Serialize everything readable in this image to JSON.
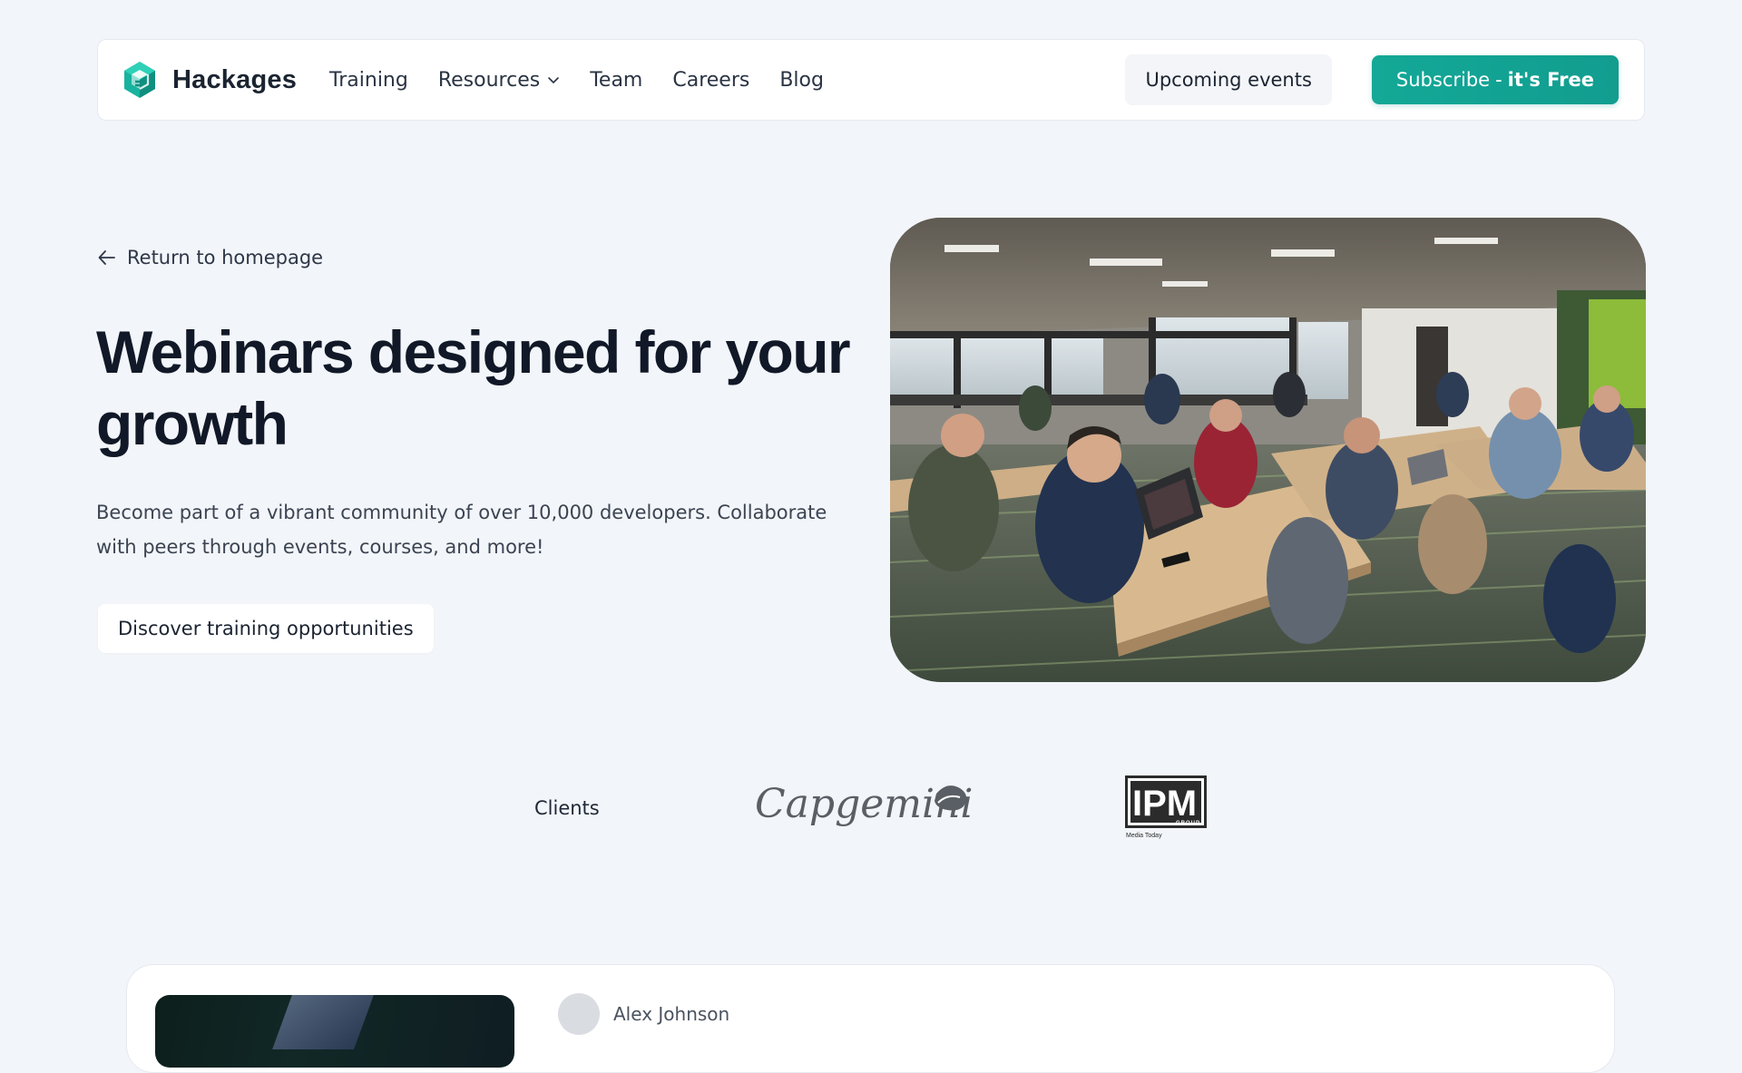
{
  "nav": {
    "brand": "Hackages",
    "links": [
      {
        "label": "Training"
      },
      {
        "label": "Resources",
        "has_dropdown": true
      },
      {
        "label": "Team"
      },
      {
        "label": "Careers"
      },
      {
        "label": "Blog"
      }
    ],
    "events_label": "Upcoming events",
    "subscribe": {
      "label": "Subscribe",
      "separator": "-",
      "emphasis": "it's Free"
    }
  },
  "hero": {
    "back_label": "Return to homepage",
    "title": "Webinars designed for your growth",
    "description": "Become part of a vibrant community of over 10,000 developers. Collaborate with peers through events, courses, and more!",
    "cta_label": "Discover training opportunities"
  },
  "clients": {
    "label": "Clients",
    "logos": [
      {
        "name": "Capgemini",
        "text": "Capgemini"
      },
      {
        "name": "IPM Group",
        "text": "IPM",
        "group": "GROUP",
        "tagline": "Media Today"
      }
    ]
  },
  "testimonial": {
    "author": "Alex Johnson"
  },
  "colors": {
    "accent": "#129d8f",
    "background": "#f2f5f9",
    "text": "#111827"
  },
  "icons": {
    "brand": "hackages-logo-icon",
    "dropdown": "chevron-down-icon",
    "back": "arrow-left-icon"
  }
}
